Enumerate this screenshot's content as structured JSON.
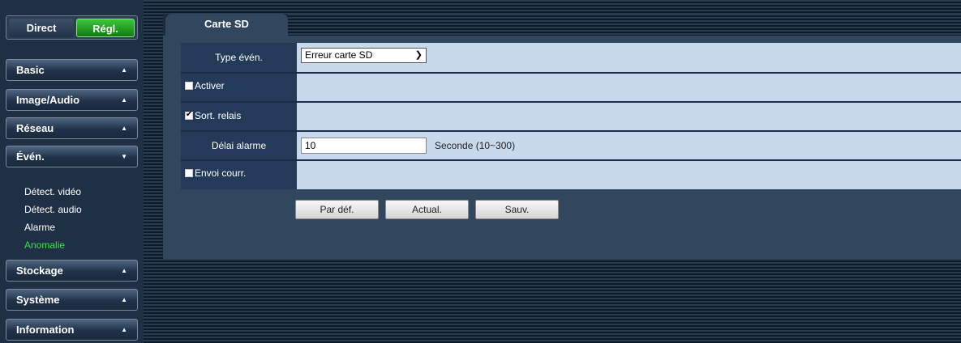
{
  "mode": {
    "direct_label": "Direct",
    "regl_label": "Régl."
  },
  "menu": {
    "basic": "Basic",
    "image_audio": "Image/Audio",
    "reseau": "Réseau",
    "even": "Évén.",
    "stockage": "Stockage",
    "systeme": "Système",
    "information": "Information",
    "even_sub": [
      "Détect. vidéo",
      "Détect. audio",
      "Alarme",
      "Anomalie"
    ],
    "active_sub": "Anomalie"
  },
  "tab": {
    "label": "Carte SD"
  },
  "form": {
    "type_label": "Type évén.",
    "type_value": "Erreur carte SD",
    "activer_label": "Activer",
    "activer_checked": false,
    "relais_label": "Sort. relais",
    "relais_checked": true,
    "delai_label": "Délai alarme",
    "delai_value": "10",
    "delai_unit": "Seconde (10~300)",
    "envoi_label": "Envoi courr.",
    "envoi_checked": false
  },
  "buttons": {
    "default": "Par déf.",
    "refresh": "Actual.",
    "save": "Sauv."
  },
  "colors": {
    "active_green": "#36e34a",
    "form_value_bg": "#c9d9ec",
    "form_label_bg": "#233b58"
  }
}
